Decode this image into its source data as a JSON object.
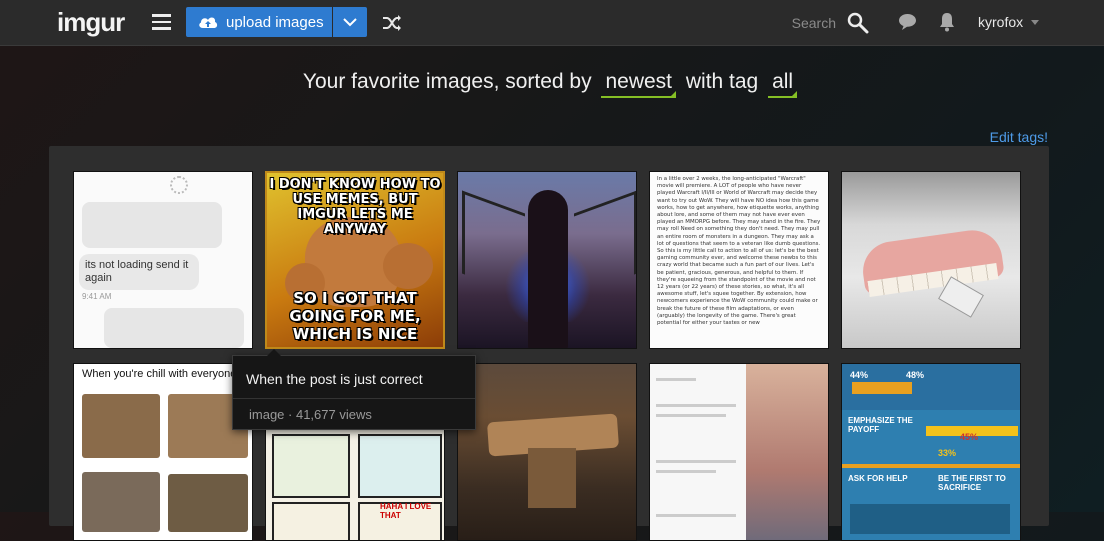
{
  "header": {
    "logo": "imgur",
    "upload_label": "upload images",
    "search_placeholder": "Search",
    "username": "kyrofox"
  },
  "headline": {
    "prefix": "Your favorite images, sorted by",
    "sort_value": "newest",
    "middle": "with tag",
    "tag_value": "all"
  },
  "edit_tags": "Edit tags!",
  "colors": {
    "topbar": "#2b2b2b",
    "upload_button": "#2e7bd0",
    "accent_green": "#85bf25",
    "link_blue": "#4e9be8"
  },
  "thumbs": {
    "t1_text": "its not loading send it again",
    "t1_time": "9:41 AM",
    "t2_top": "I DON'T KNOW HOW TO USE MEMES, BUT IMGUR LETS ME ANYWAY",
    "t2_bottom": "SO I GOT THAT GOING FOR ME, WHICH IS NICE",
    "t4_text": "In a little over 2 weeks, the long-anticipated \"Warcraft\" movie will premiere. A LOT of people who have never played Warcraft I/II/III or World of Warcraft may decide they want to try out WoW. They will have NO idea how this game works, how to get anywhere, how etiquette works, anything about lore, and some of them may not have ever even played an MMORPG before. They may stand in the fire. They may roll Need on something they don't need. They may pull an entire room of monsters in a dungeon. They may ask a lot of questions that seem to a veteran like dumb questions. So this is my little call to action to all of us: let's be the best gaming community ever, and welcome these newbs to this crazy world that became such a fun part of our lives. Let's be patient, gracious, generous, and helpful to them. If they're squeeing from the standpoint of the movie and not 12 years (or 22 years) of these stories, so what, it's all awesome stuff, let's squee together. By extension, how newcomers experience the WoW community could make or break the future of these film adaptations, or even (arguably) the longevity of the game. There's great potential for either your tastes or new",
    "t6_caption": "When you're chill with everyone",
    "t7_text": "HAHA I LOVE THAT",
    "t10_pct1": "44%",
    "t10_pct2": "48%",
    "t10_heading": "EMPHASIZE THE PAYOFF",
    "t10_pct3": "45%",
    "t10_pct4": "33%",
    "t10_heading2": "ASK FOR HELP",
    "t10_heading3": "BE THE FIRST TO SACRIFICE"
  },
  "tooltip": {
    "title": "When the post is just correct",
    "meta": "image · 41,677 views"
  }
}
